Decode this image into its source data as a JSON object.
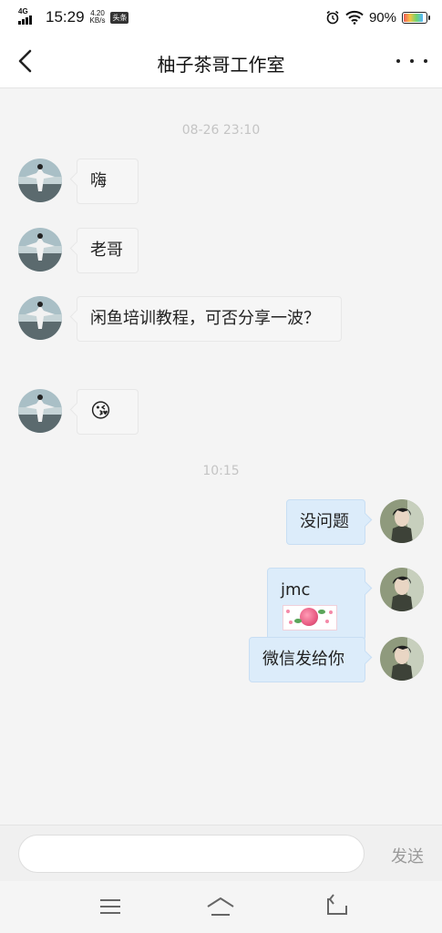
{
  "status_bar": {
    "network": "4G",
    "time": "15:29",
    "speed_value": "4.20",
    "speed_unit": "KB/s",
    "app_badge": "头条",
    "battery_text": "90%",
    "battery_level": 0.9
  },
  "header": {
    "title": "柚子茶哥工作室",
    "back_icon": "chevron-left-icon",
    "more_icon": "more-horizontal-icon"
  },
  "chat": {
    "timestamps": [
      "08-26 23:10",
      "10:15"
    ],
    "incoming": [
      {
        "text": "嗨"
      },
      {
        "text": "老哥"
      },
      {
        "text": "闲鱼培训教程，可否分享一波？"
      },
      {
        "text": "😘"
      }
    ],
    "outgoing": [
      {
        "text": "没问题"
      },
      {
        "text": "jmc"
      },
      {
        "text": "微信发给你"
      }
    ]
  },
  "input": {
    "value": "",
    "send_label": "发送"
  },
  "system_nav": {
    "menu_icon": "menu-icon",
    "home_icon": "home-icon",
    "back_icon": "back-arrow-icon"
  },
  "colors": {
    "incoming_bubble": "#f6f6f6",
    "outgoing_bubble": "#dcecfa",
    "timestamp": "#c4c4c4",
    "page_bg": "#f4f4f4"
  }
}
